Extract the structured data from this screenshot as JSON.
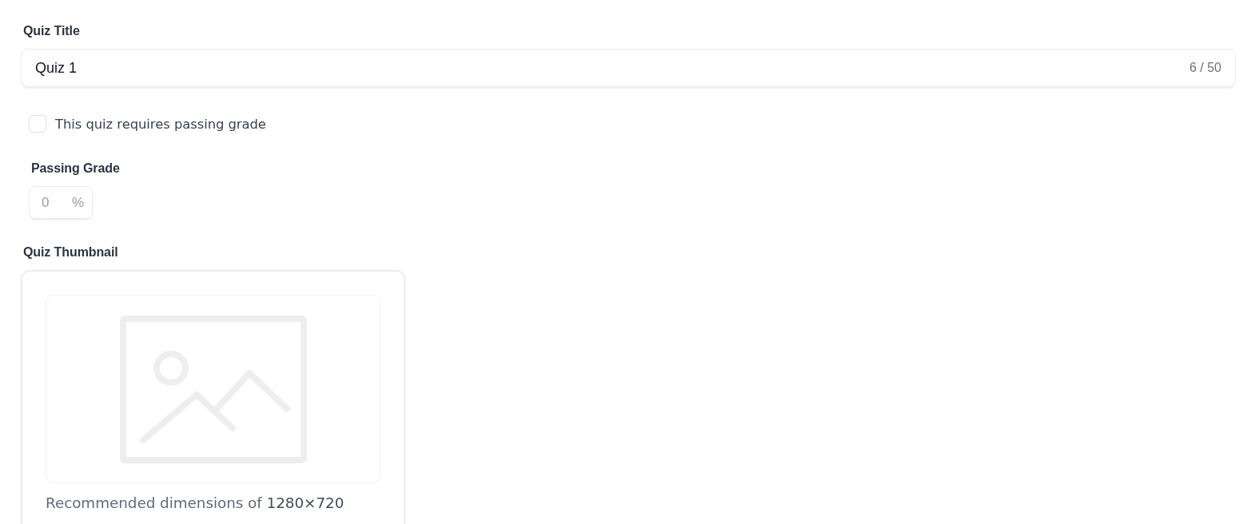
{
  "quiz_title": {
    "label": "Quiz Title",
    "value": "Quiz 1",
    "counter": "6 / 50"
  },
  "passing_grade_toggle": {
    "label": "This quiz requires passing grade",
    "checked": false
  },
  "passing_grade": {
    "label": "Passing Grade",
    "value": "0",
    "unit": "%",
    "disabled": true
  },
  "quiz_thumbnail": {
    "label": "Quiz Thumbnail",
    "caption": "Recommended dimensions of **1280×720**"
  }
}
